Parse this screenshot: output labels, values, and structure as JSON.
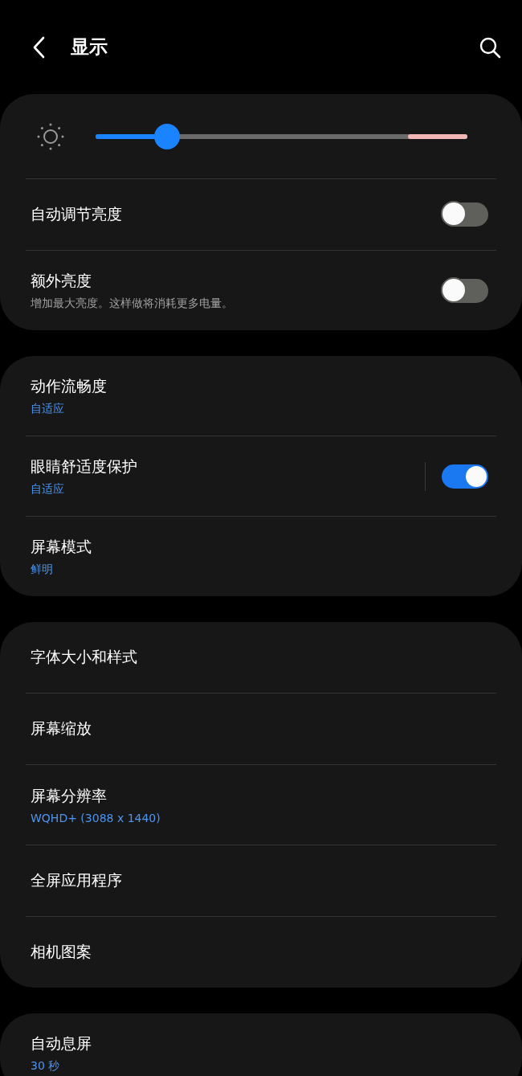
{
  "header": {
    "title": "显示"
  },
  "cards": [
    {
      "items": [
        {
          "kind": "slider",
          "level": 0.18
        },
        {
          "kind": "switch",
          "title": "自动调节亮度",
          "on": false,
          "divider": false
        },
        {
          "kind": "switch",
          "title": "额外亮度",
          "description": "增加最大亮度。这样做将消耗更多电量。",
          "on": false,
          "divider": false
        }
      ]
    },
    {
      "items": [
        {
          "kind": "nav",
          "title": "动作流畅度",
          "value": "自适应"
        },
        {
          "kind": "switch",
          "title": "眼睛舒适度保护",
          "value": "自适应",
          "on": true,
          "divider": true
        },
        {
          "kind": "nav",
          "title": "屏幕模式",
          "value": "鲜明"
        }
      ]
    },
    {
      "items": [
        {
          "kind": "nav",
          "title": "字体大小和样式"
        },
        {
          "kind": "nav",
          "title": "屏幕缩放"
        },
        {
          "kind": "nav",
          "title": "屏幕分辨率",
          "value": "WQHD+ (3088 x 1440)"
        },
        {
          "kind": "nav",
          "title": "全屏应用程序"
        },
        {
          "kind": "nav",
          "title": "相机图案"
        }
      ]
    },
    {
      "items": [
        {
          "kind": "nav",
          "title": "自动息屏",
          "value": "30 秒"
        }
      ]
    }
  ]
}
